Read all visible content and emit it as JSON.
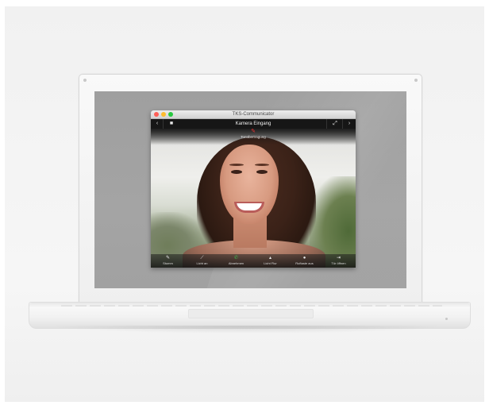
{
  "window": {
    "title": "TKS-Communicator",
    "traffic_light_colors": [
      "#ff5f57",
      "#febc2e",
      "#28c840"
    ]
  },
  "navbar": {
    "back_icon": "chevron-left-icon",
    "camera_title": "Kamera Eingang",
    "forward_icon": "chevron-right-icon"
  },
  "video": {
    "mic_status_label": "Tonübertragung"
  },
  "toolbar": {
    "buttons": [
      {
        "label": "Stumm",
        "icon": "mic-icon"
      },
      {
        "label": "Licht an",
        "icon": "light-icon"
      },
      {
        "label": "Abnehmen",
        "icon": "phone-icon"
      },
      {
        "label": "Licht Flur",
        "icon": "lamp-icon"
      },
      {
        "label": "Ruftaste aus",
        "icon": "person-icon"
      },
      {
        "label": "Tür öffnen",
        "icon": "door-icon"
      }
    ]
  },
  "colors": {
    "screen_bg": "#a2a2a2",
    "window_bg": "#1b1b1b",
    "mic_icon": "#ee3333",
    "accept_icon": "#3bbf4f"
  }
}
